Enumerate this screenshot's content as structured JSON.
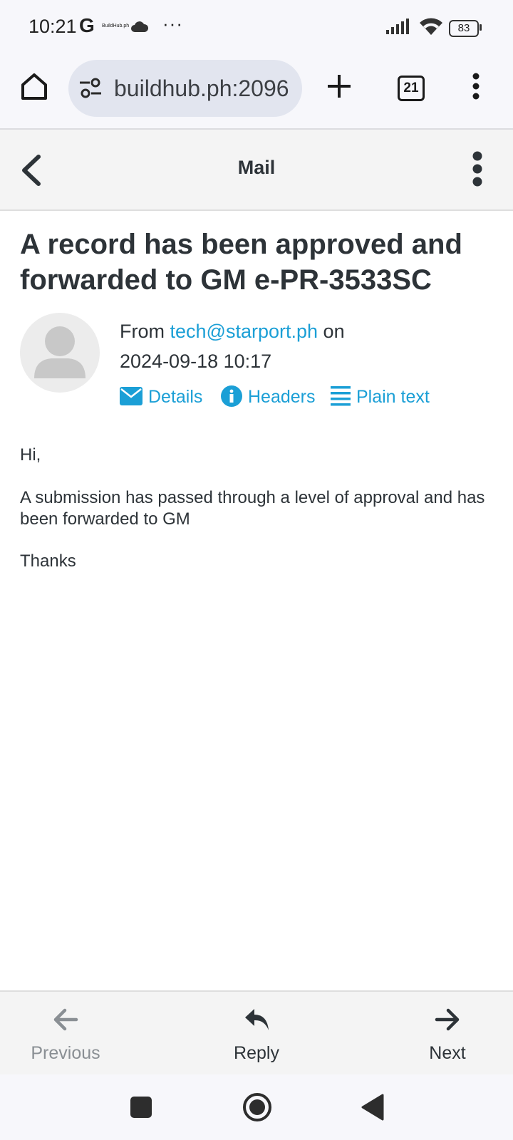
{
  "status": {
    "time": "10:21",
    "g_glyph": "G",
    "mini_text": "BuildHub.ph",
    "more_dots": "···",
    "battery": "83"
  },
  "browser": {
    "url": "buildhub.ph:2096",
    "tab_count": "21"
  },
  "mail": {
    "header_title": "Mail",
    "subject": "A record has been approved and forwarded to GM e-PR-3533SC",
    "from_label": "From",
    "from_address": "tech@starport.ph",
    "on_label": "on",
    "date": "2024-09-18 10:17",
    "actions": {
      "details": "Details",
      "headers": "Headers",
      "plain_text": "Plain text"
    },
    "body": {
      "greeting": "Hi,",
      "paragraph": "A submission has passed through a level of approval and has been forwarded to GM",
      "closing": "Thanks"
    }
  },
  "bottom_nav": {
    "previous": "Previous",
    "reply": "Reply",
    "next": "Next"
  },
  "colors": {
    "link": "#1b9fd6",
    "text": "#2d3338",
    "disabled": "#8a8f94"
  }
}
